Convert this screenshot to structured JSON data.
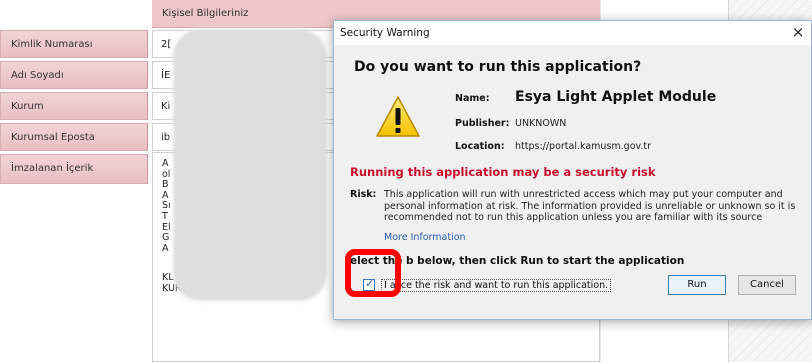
{
  "form": {
    "header": "Kişisel Bilgileriniz",
    "rows": [
      {
        "label": "Kimlik Numarası",
        "value": "2["
      },
      {
        "label": "Adı Soyadı",
        "value": "İE"
      },
      {
        "label": "Kurum",
        "value": "Ki"
      },
      {
        "label": "Kurumsal Eposta",
        "value": "ib"
      },
      {
        "label": "İmzalanan İçerik",
        "value": ""
      }
    ],
    "content_lines": [
      "A",
      "ol",
      "B",
      "A",
      "Sı",
      "T",
      "El",
      "G",
      "A"
    ],
    "content_tail": [
      "KL",
      "KUR"
    ]
  },
  "dialog": {
    "title": "Security Warning",
    "question": "Do you want to run this application?",
    "name_label": "Name:",
    "name_value": "Esya Light Applet Module",
    "publisher_label": "Publisher:",
    "publisher_value": "UNKNOWN",
    "location_label": "Location:",
    "location_value": "https://portal.kamusm.gov.tr",
    "risk_heading": "Running this application may be a security risk",
    "risk_label": "Risk:",
    "risk_text": "This application will run with unrestricted access which may put your computer and personal information at risk. The information provided is unreliable or unknown so it is recommended not to run this application unless you are familiar with its source",
    "more_info": "More Information",
    "select_instruction": "elect the b   below, then click Run to start the application",
    "checkbox_label": "I acce   the risk and want to run this application.",
    "checkbox_checked": true,
    "run_label": "Run",
    "cancel_label": "Cancel",
    "close_glyph": "×"
  },
  "colors": {
    "label_cell": "#ecc6c9",
    "risk_red": "#c8102e",
    "highlight": "#ff0000",
    "link_blue": "#2a5db0"
  }
}
